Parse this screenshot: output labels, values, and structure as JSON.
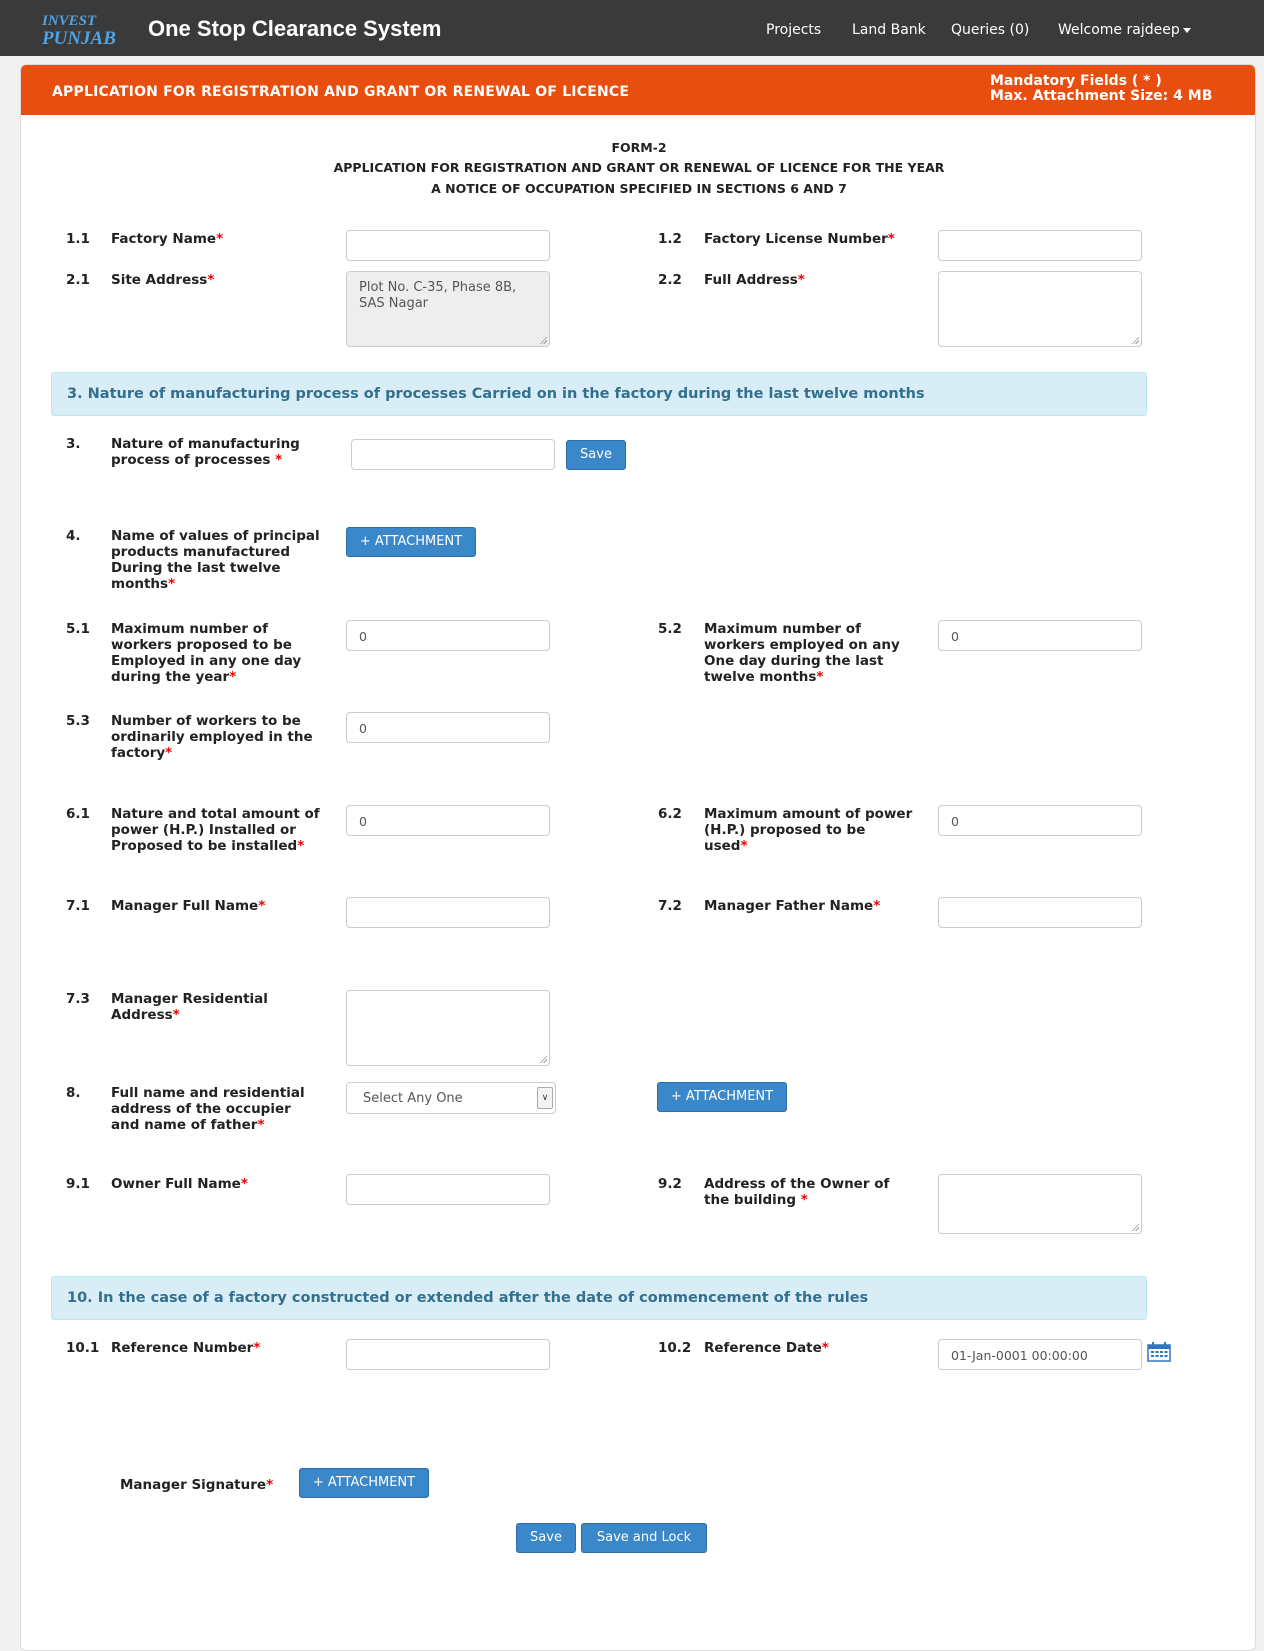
{
  "navbar": {
    "logo_top": "INVEST",
    "logo_bottom": "PUNJAB",
    "brand": "One Stop Clearance System",
    "links": [
      "Projects",
      "Land Bank",
      "Queries (0)"
    ],
    "user": "Welcome rajdeep"
  },
  "panel": {
    "title": "APPLICATION FOR REGISTRATION AND GRANT OR RENEWAL OF LICENCE",
    "note_line1": "Mandatory Fields ( * )",
    "note_line2": "Max. Attachment Size: 4 MB"
  },
  "form_header": {
    "form_no": "FORM-2",
    "line1": "APPLICATION FOR REGISTRATION AND GRANT OR RENEWAL OF LICENCE FOR THE YEAR",
    "line2": "A NOTICE OF OCCUPATION SPECIFIED IN SECTIONS 6 AND 7"
  },
  "required_mark": "*",
  "fields": {
    "f1_1": {
      "num": "1.1",
      "label": "Factory Name",
      "value": ""
    },
    "f1_2": {
      "num": "1.2",
      "label": "Factory License Number",
      "value": ""
    },
    "f2_1": {
      "num": "2.1",
      "label": "Site Address",
      "value": "Plot No. C-35, Phase 8B, SAS Nagar"
    },
    "f2_2": {
      "num": "2.2",
      "label": "Full Address",
      "value": ""
    },
    "f3": {
      "num": "3.",
      "label_l1": "Nature of manufacturing",
      "label_l2": "process of processes",
      "value": ""
    },
    "f4": {
      "num": "4.",
      "label_l1": "Name of values of principal",
      "label_l2": "products manufactured",
      "label_l3": "During the last twelve",
      "label_l4": "months"
    },
    "f5_1": {
      "num": "5.1",
      "label_l1": "Maximum number of",
      "label_l2": "workers proposed to be",
      "label_l3": "Employed in any one day",
      "label_l4": "during the year",
      "value": "0"
    },
    "f5_2": {
      "num": "5.2",
      "label_l1": "Maximum number of",
      "label_l2": "workers employed on any",
      "label_l3": "One day during the last",
      "label_l4": "twelve months",
      "value": "0"
    },
    "f5_3": {
      "num": "5.3",
      "label_l1": "Number of workers to be",
      "label_l2": "ordinarily employed in the",
      "label_l3": "factory",
      "value": "0"
    },
    "f6_1": {
      "num": "6.1",
      "label_l1": "Nature and total amount of",
      "label_l2": "power (H.P.) Installed or",
      "label_l3": "Proposed to be installed",
      "value": "0"
    },
    "f6_2": {
      "num": "6.2",
      "label_l1": "Maximum amount of power",
      "label_l2": "(H.P.) proposed to be",
      "label_l3": "used",
      "value": "0"
    },
    "f7_1": {
      "num": "7.1",
      "label": "Manager Full Name",
      "value": ""
    },
    "f7_2": {
      "num": "7.2",
      "label": "Manager Father Name",
      "value": ""
    },
    "f7_3": {
      "num": "7.3",
      "label_l1": "Manager Residential",
      "label_l2": "Address",
      "value": ""
    },
    "f8": {
      "num": "8.",
      "label_l1": "Full name and residential",
      "label_l2": "address of the occupier",
      "label_l3": "and name of father",
      "selected": "Select Any One"
    },
    "f9_1": {
      "num": "9.1",
      "label": "Owner Full Name",
      "value": ""
    },
    "f9_2": {
      "num": "9.2",
      "label_l1": "Address of the Owner of",
      "label_l2": "the building",
      "value": ""
    },
    "f10_1": {
      "num": "10.1",
      "label": "Reference Number",
      "value": ""
    },
    "f10_2": {
      "num": "10.2",
      "label": "Reference Date",
      "value": "01-Jan-0001 00:00:00"
    },
    "signature": {
      "label": "Manager Signature"
    }
  },
  "sections": {
    "s3": "3. Nature of manufacturing process of processes Carried on in the factory during the last twelve months",
    "s10": "10. In the case of a factory constructed or extended after the date of commencement of the rules"
  },
  "buttons": {
    "save_small": "Save",
    "attachment": "+ ATTACHMENT",
    "save": "Save",
    "save_lock": "Save and Lock"
  },
  "colors": {
    "navbar": "#3a3a3a",
    "header_orange": "#e84e0f",
    "section_bg": "#d9edf7",
    "section_text": "#31708f",
    "button_blue": "#3a87c9",
    "required_red": "#e00000"
  },
  "icons": [
    "calendar-icon",
    "chevron-down-icon",
    "caret-down-icon"
  ]
}
